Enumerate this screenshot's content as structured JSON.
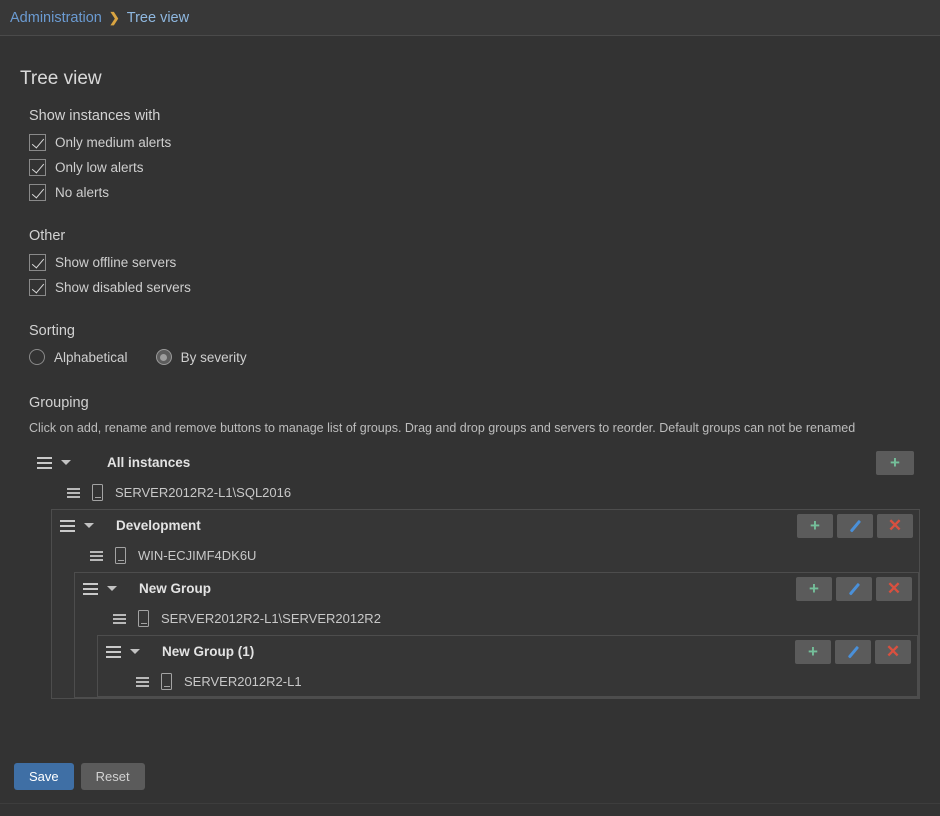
{
  "breadcrumb": {
    "parent": "Administration",
    "separator": "❯",
    "current": "Tree view"
  },
  "page": {
    "title": "Tree view"
  },
  "sections": {
    "show_instances": {
      "heading": "Show instances with",
      "items": [
        {
          "label": "Only medium alerts",
          "checked": true
        },
        {
          "label": "Only low alerts",
          "checked": true
        },
        {
          "label": "No alerts",
          "checked": true
        }
      ]
    },
    "other": {
      "heading": "Other",
      "items": [
        {
          "label": "Show offline servers",
          "checked": true
        },
        {
          "label": "Show disabled servers",
          "checked": true
        }
      ]
    },
    "sorting": {
      "heading": "Sorting",
      "options": [
        {
          "label": "Alphabetical",
          "selected": false
        },
        {
          "label": "By severity",
          "selected": true
        }
      ]
    },
    "grouping": {
      "heading": "Grouping",
      "hint": "Click on add, rename and remove buttons to manage list of groups. Drag and drop groups and servers to reorder. Default groups can not be renamed"
    }
  },
  "tree": {
    "root": {
      "title": "All instances",
      "add_label": "+",
      "servers": [
        {
          "name": "SERVER2012R2-L1\\SQL2016"
        }
      ]
    },
    "group1": {
      "title": "Development",
      "add_label": "+",
      "rename_label": "",
      "remove_label": "✕",
      "servers": [
        {
          "name": "WIN-ECJIMF4DK6U"
        }
      ]
    },
    "group2": {
      "title": "New Group",
      "add_label": "+",
      "rename_label": "",
      "remove_label": "✕",
      "servers": [
        {
          "name": "SERVER2012R2-L1\\SERVER2012R2"
        }
      ]
    },
    "group3": {
      "title": "New Group (1)",
      "add_label": "+",
      "rename_label": "",
      "remove_label": "✕",
      "servers": [
        {
          "name": "SERVER2012R2-L1"
        }
      ]
    }
  },
  "footer": {
    "save_label": "Save",
    "reset_label": "Reset"
  },
  "colors": {
    "page_bg": "#333333",
    "header_bg": "#383838",
    "accent_link": "#6b9bd2",
    "breadcrumb_sep": "#d9a441",
    "save_button": "#3f6fa5",
    "add_icon": "#74bf9a",
    "rename_icon": "#4a90d9",
    "remove_icon": "#d9503f",
    "group_border": "#4d4d4d"
  }
}
